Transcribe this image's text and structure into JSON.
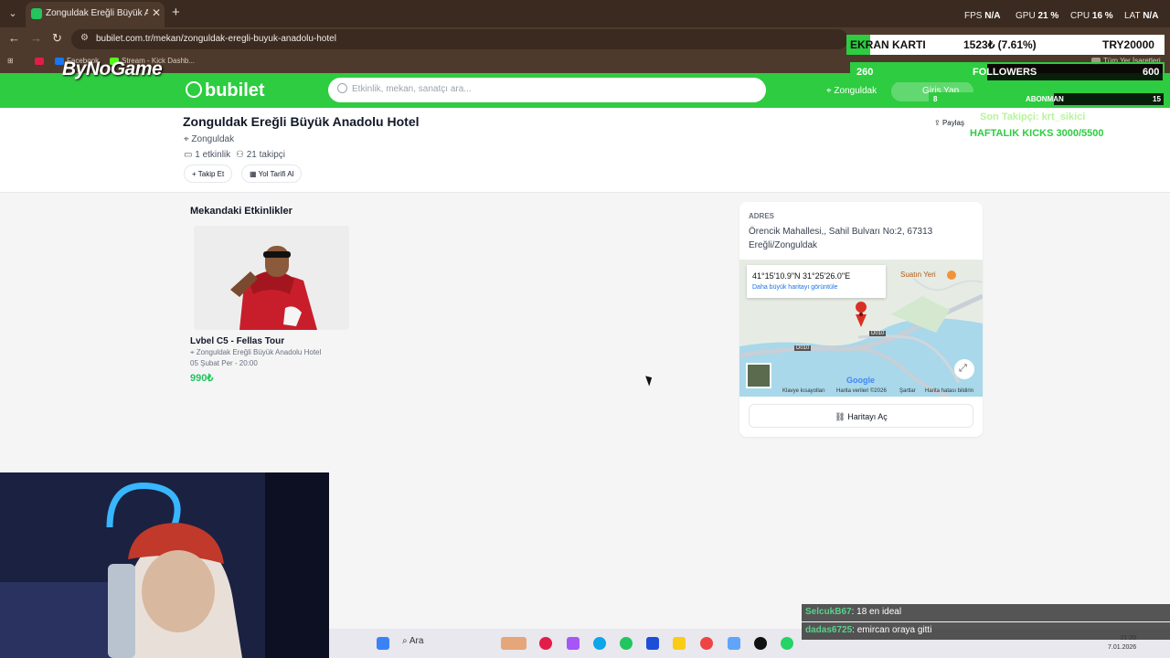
{
  "browser": {
    "tab_title": "Zonguldak Ereğli Büyük Anadolu",
    "url": "bubilet.com.tr/mekan/zonguldak-eregli-buyuk-anadolu-hotel",
    "bookmarks": [
      "Facebook",
      "Stream - Kick Dashb...",
      "Tüm Yer İşaretleri"
    ],
    "stats": {
      "fps_label": "FPS",
      "fps": "N/A",
      "gpu_label": "GPU",
      "gpu": "21 %",
      "cpu_label": "CPU",
      "cpu": "16 %",
      "lat_label": "LAT",
      "lat": "N/A"
    }
  },
  "overlay": {
    "brand": "ByNoGame",
    "gpu_label": "EKRAN KARTI",
    "gpu_price": "1523₺ (7.61%)",
    "gpu_total": "TRY20000",
    "followers_count": "260",
    "followers_label": "FOLLOWERS",
    "followers_goal": "600",
    "sub_count": "8",
    "sub_label": "ABONMAN",
    "sub_goal": "15",
    "last_follower": "Son Takipçi: krt_sikici",
    "weekly_kicks": "HAFTALIK KICKS 3000/5500"
  },
  "site": {
    "logo": "bubilet",
    "search_placeholder": "Etkinlik, mekan, sanatçı ara...",
    "location": "Zonguldak",
    "login": "Giriş Yap"
  },
  "venue": {
    "title": "Zonguldak Ereğli Büyük Anadolu Hotel",
    "city": "Zonguldak",
    "events_count": "1 etkinlik",
    "followers": "21 takipçi",
    "follow_button": "Takip Et",
    "directions_button": "Yol Tarifi Al",
    "share": "Paylaş"
  },
  "events": {
    "heading": "Mekandaki Etkinlikler",
    "items": [
      {
        "name": "Lvbel C5 - Fellas Tour",
        "venue": "Zonguldak Ereğli Büyük Anadolu Hotel",
        "date": "05 Şubat Per - 20:00",
        "price": "990₺"
      }
    ]
  },
  "address": {
    "label": "ADRES",
    "text": "Örencik Mahallesi,, Sahil Bulvarı No:2, 67313 Ereğli/Zonguldak",
    "coords": "41°15'10.9\"N 31°25'26.0\"E",
    "bigger_map": "Daha büyük haritayı görüntüle",
    "poi": "Suatın Yeri",
    "road1": "D010",
    "road2": "D010",
    "google": "Google",
    "footer": [
      "Klavye kısayolları",
      "Harita verileri ©2026",
      "Şartlar",
      "Harita hatası bildirin"
    ],
    "open_map": "Haritayı Aç"
  },
  "taskbar": {
    "search": "Ara",
    "time": "21:20",
    "date": "7.01.2026"
  },
  "chat": [
    {
      "user": "SelcukB67",
      "message": ": 18 en ideal"
    },
    {
      "user": "dadas6725",
      "message": ": emircan oraya gitti"
    }
  ]
}
